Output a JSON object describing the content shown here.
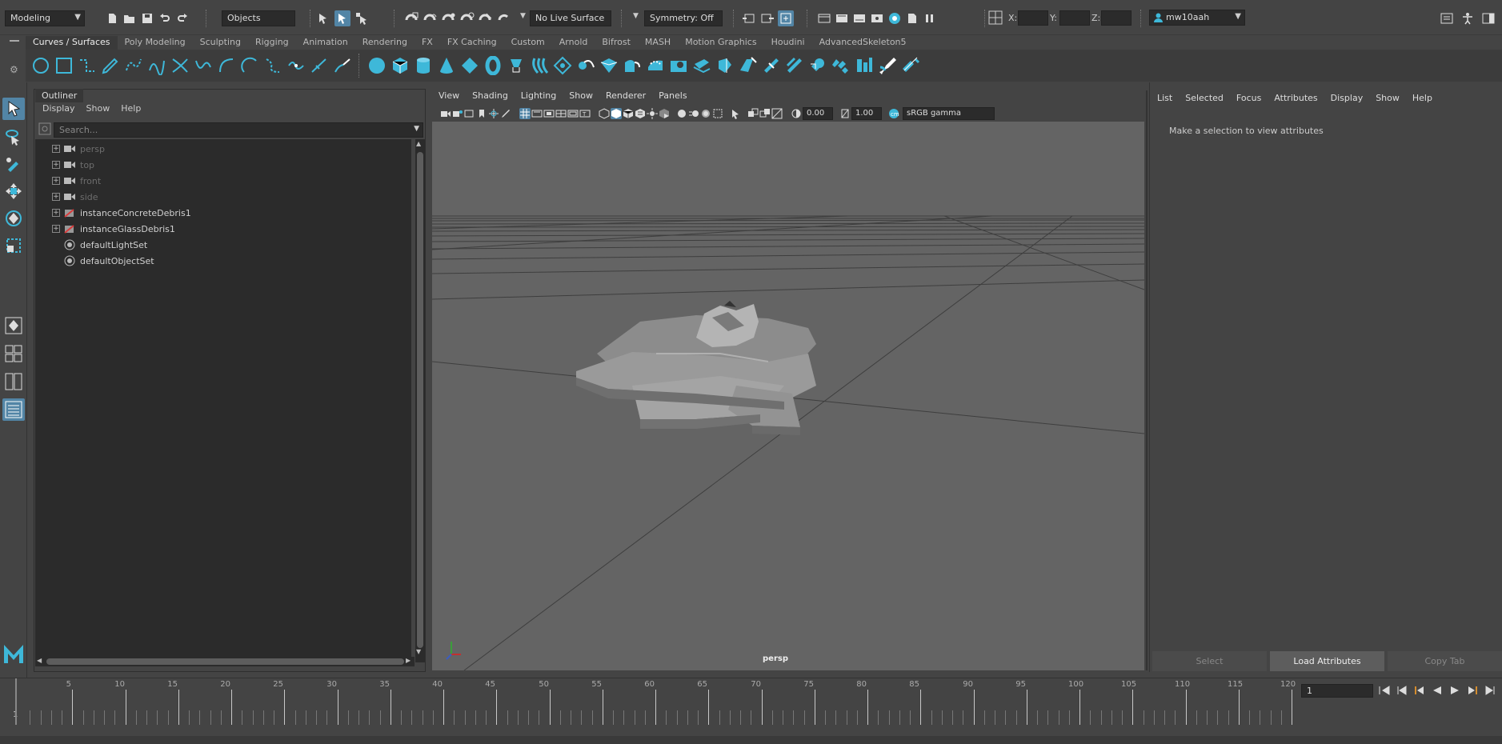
{
  "status_line": {
    "menu_set": "Modeling",
    "selection_mode": "Objects",
    "live_surface": "No Live Surface",
    "symmetry": "Symmetry: Off",
    "xform_x_label": "X:",
    "xform_y_label": "Y:",
    "xform_z_label": "Z:",
    "user": "mw10aah"
  },
  "shelf": {
    "tabs": [
      "Curves / Surfaces",
      "Poly Modeling",
      "Sculpting",
      "Rigging",
      "Animation",
      "Rendering",
      "FX",
      "FX Caching",
      "Custom",
      "Arnold",
      "Bifrost",
      "MASH",
      "Motion Graphics",
      "Houdini",
      "AdvancedSkeleton5"
    ],
    "active_tab": "Curves / Surfaces"
  },
  "outliner": {
    "title": "Outliner",
    "menu": [
      "Display",
      "Show",
      "Help"
    ],
    "search_placeholder": "Search...",
    "items": [
      {
        "label": "persp",
        "icon": "camera-icon",
        "expand": true,
        "dim": true
      },
      {
        "label": "top",
        "icon": "camera-icon",
        "expand": true,
        "dim": true
      },
      {
        "label": "front",
        "icon": "camera-icon",
        "expand": true,
        "dim": true
      },
      {
        "label": "side",
        "icon": "camera-icon",
        "expand": true,
        "dim": true
      },
      {
        "label": "instanceConcreteDebris1",
        "icon": "instancer-icon",
        "expand": true,
        "dim": false
      },
      {
        "label": "instanceGlassDebris1",
        "icon": "instancer-icon",
        "expand": true,
        "dim": false
      },
      {
        "label": "defaultLightSet",
        "icon": "set-icon",
        "expand": false,
        "dim": false
      },
      {
        "label": "defaultObjectSet",
        "icon": "set-icon",
        "expand": false,
        "dim": false
      }
    ]
  },
  "viewport": {
    "menu": [
      "View",
      "Shading",
      "Lighting",
      "Show",
      "Renderer",
      "Panels"
    ],
    "exposure": "0.00",
    "gamma": "1.00",
    "color_space": "sRGB gamma",
    "camera": "persp"
  },
  "attribute_editor": {
    "menu": [
      "List",
      "Selected",
      "Focus",
      "Attributes",
      "Display",
      "Show",
      "Help"
    ],
    "message": "Make a selection to view attributes",
    "buttons": [
      "Select",
      "Load Attributes",
      "Copy Tab"
    ]
  },
  "timeline": {
    "ticks": [
      "5",
      "10",
      "15",
      "20",
      "25",
      "30",
      "35",
      "40",
      "45",
      "50",
      "55",
      "60",
      "65",
      "70",
      "75",
      "80",
      "85",
      "90",
      "95",
      "100",
      "105",
      "110",
      "115",
      "120"
    ],
    "start_frame": "1",
    "current_frame": "1"
  },
  "colors": {
    "accent": "#5285a6",
    "icon": "#3eb8d9",
    "panel": "#444444",
    "field": "#2b2b2b",
    "viewport_bg": "#646464"
  }
}
